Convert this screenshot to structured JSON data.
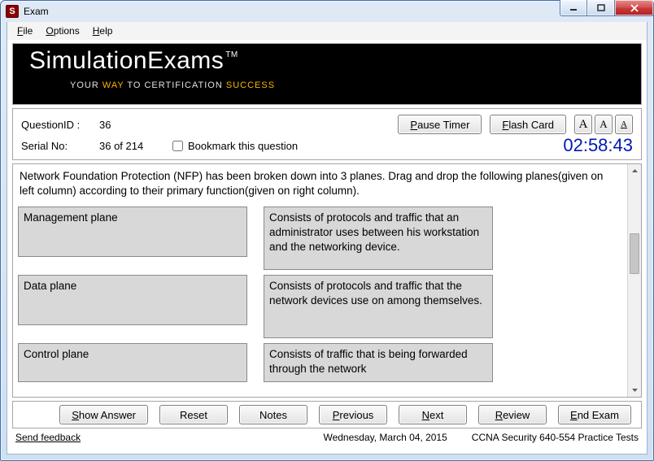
{
  "window": {
    "title": "Exam"
  },
  "menu": {
    "file": "File",
    "options": "Options",
    "help": "Help"
  },
  "brand": {
    "title_a": "Simulation",
    "title_b": "Exams",
    "tm": "TM",
    "tagline_a": "YOUR ",
    "tagline_b": "WAY",
    "tagline_c": " TO CERTIFICATION ",
    "tagline_d": "SUCCESS"
  },
  "info": {
    "qid_label": "QuestionID :",
    "qid_value": "36",
    "serial_label": "Serial No:",
    "serial_value": "36 of 214",
    "bookmark_label": "Bookmark this question"
  },
  "header_buttons": {
    "pause": "Pause Timer",
    "flash": "Flash Card"
  },
  "timer": "02:58:43",
  "font_buttons": {
    "a1": "A",
    "a2": "A",
    "a3": "A"
  },
  "question": {
    "text": "Network Foundation Protection (NFP) has been broken down into 3 planes. Drag and drop  the following planes(given on left column) according to their primary function(given on right column).",
    "rows": [
      {
        "left": "Management plane",
        "right": "Consists of protocols and traffic that an administrator uses between his workstation and the networking device."
      },
      {
        "left": "Data plane",
        "right": "Consists of protocols and traffic that the network devices use on among themselves."
      },
      {
        "left": "Control plane",
        "right": "Consists of traffic that is being forwarded through the network"
      }
    ]
  },
  "buttons": {
    "show_answer": "Show Answer",
    "reset": "Reset",
    "notes": "Notes",
    "previous": "Previous",
    "next": "Next",
    "review": "Review",
    "end_exam": "End Exam"
  },
  "status": {
    "feedback": "Send feedback",
    "date": "Wednesday, March 04, 2015",
    "test_name": "CCNA Security 640-554 Practice Tests"
  }
}
